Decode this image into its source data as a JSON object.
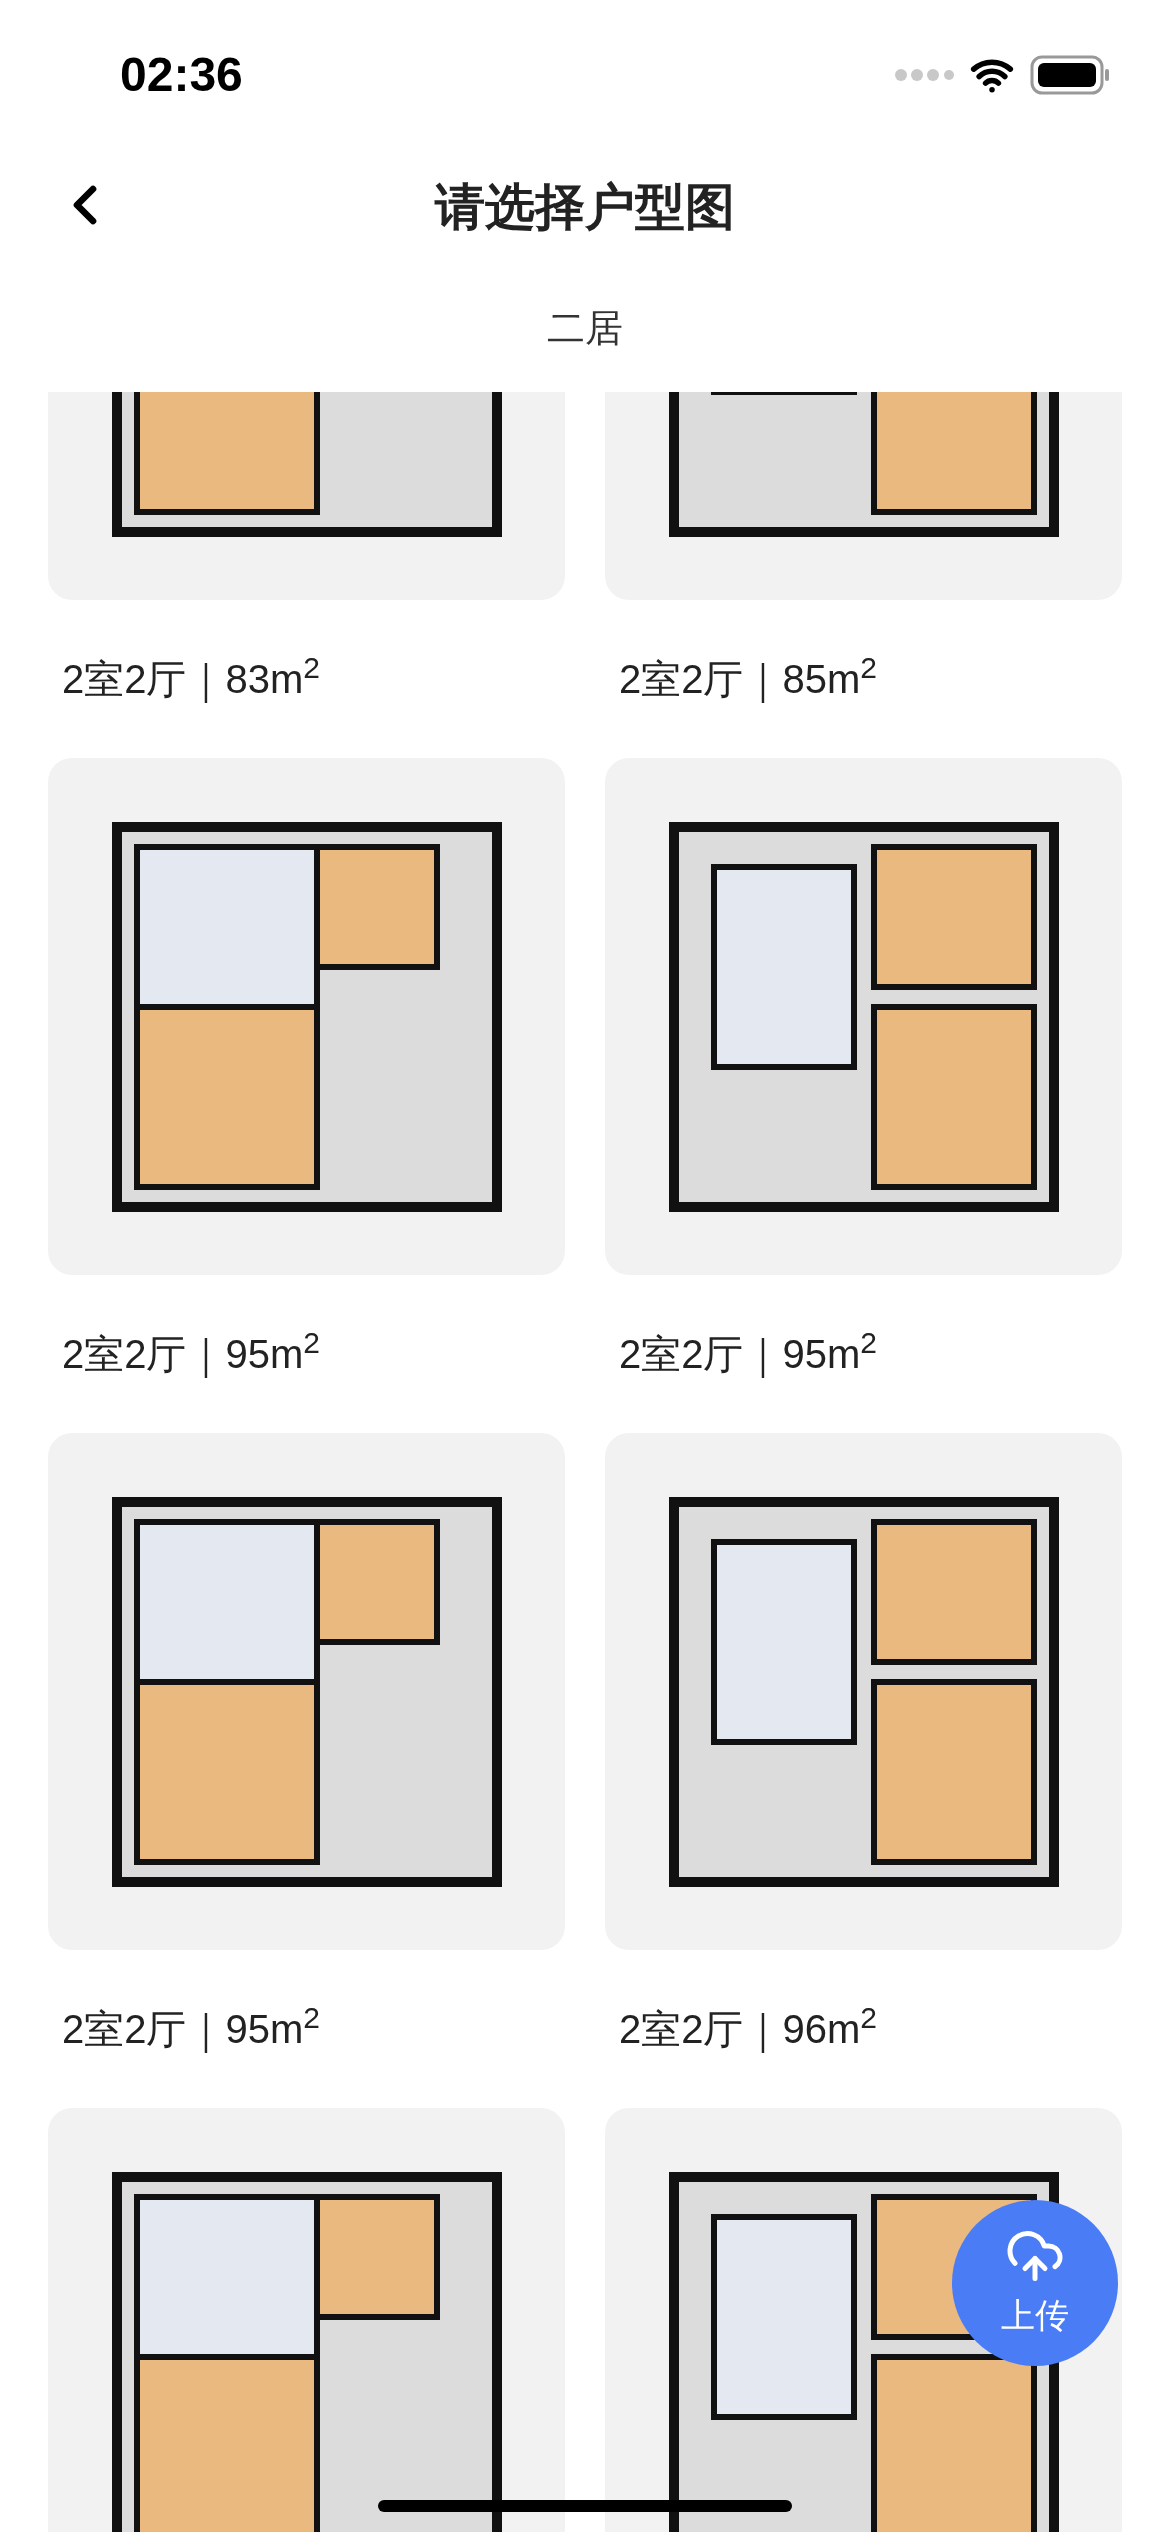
{
  "status_bar": {
    "time": "02:36"
  },
  "header": {
    "title": "请选择户型图"
  },
  "section": {
    "title": "二居"
  },
  "plans": [
    {
      "kind": "labeled",
      "label": "2室2厅｜83m$^{2}$"
    },
    {
      "kind": "labeled",
      "label": "2室2厅｜85m$^{2}$"
    },
    {
      "kind": "labeled",
      "label": "2室2厅｜95m$^{2}$"
    },
    {
      "kind": "labeled",
      "label": "2室2厅｜95m$^{2}$"
    },
    {
      "kind": "labeled",
      "label": "2室2厅｜95m$^{2}$"
    },
    {
      "kind": "labeled",
      "label": "2室2厅｜96m$^{2}$"
    },
    {
      "kind": "cut"
    },
    {
      "kind": "cut"
    }
  ],
  "upload_button": {
    "label": "上传"
  }
}
